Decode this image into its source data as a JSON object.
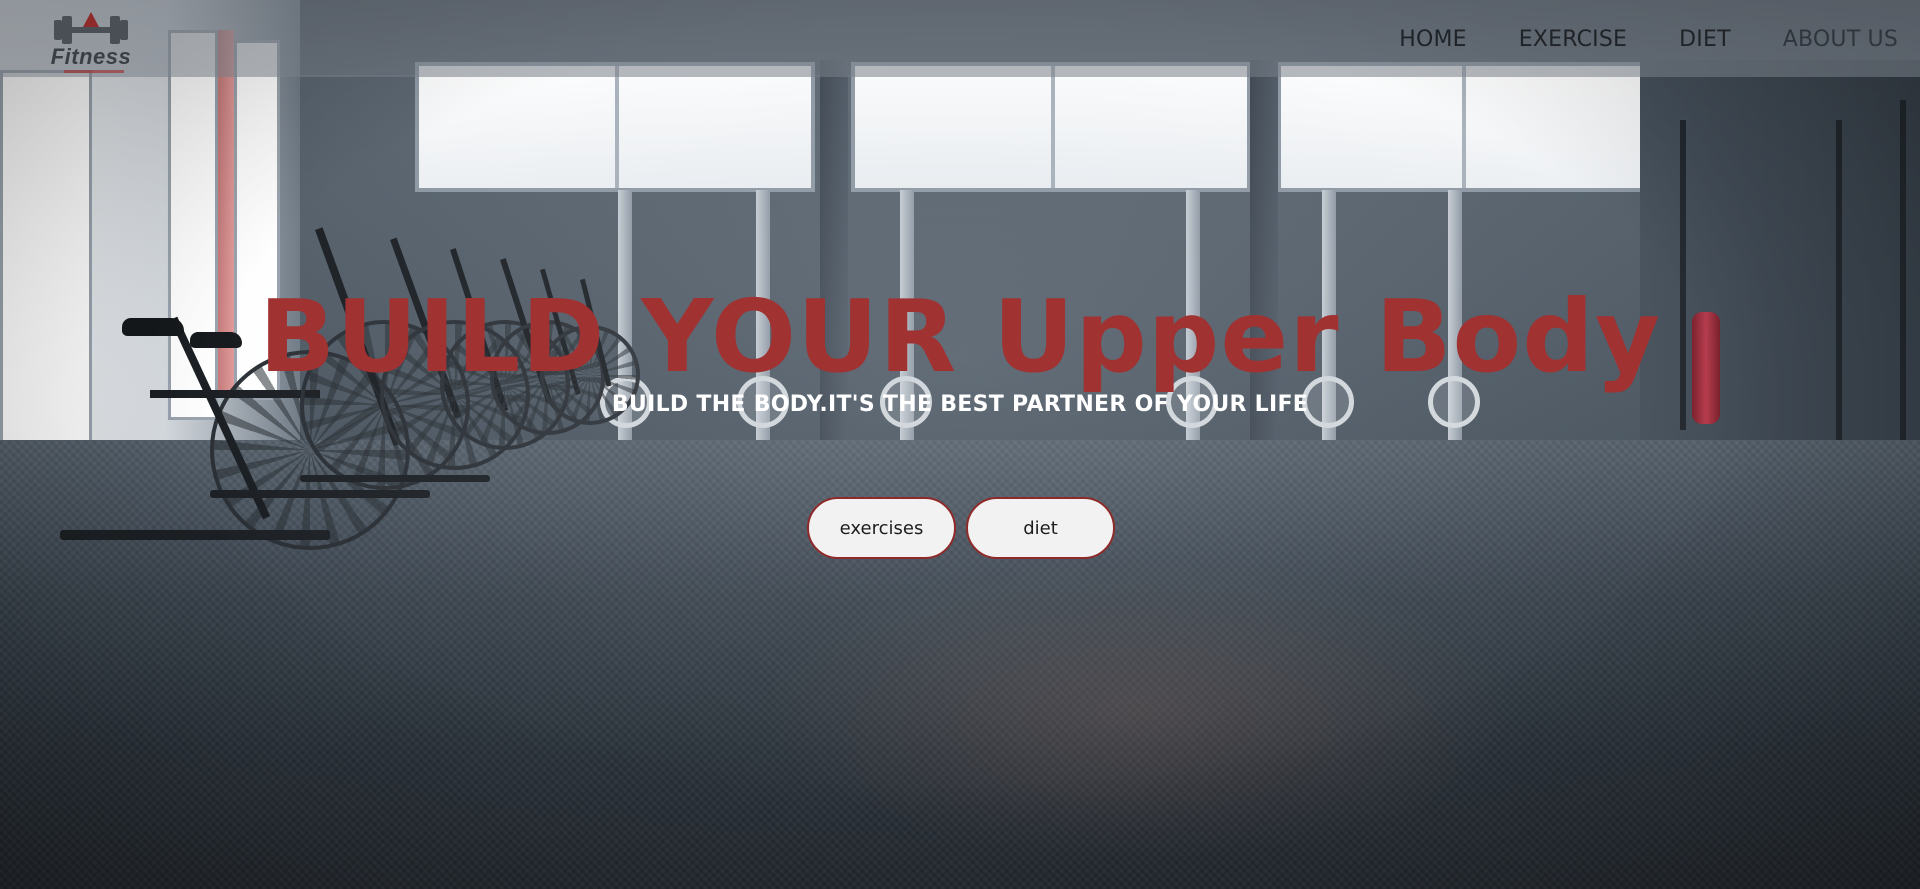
{
  "brand": {
    "logo_text": "Fitness",
    "logo_icon": "dumbbell-icon",
    "accent_color": "#a03232"
  },
  "nav": {
    "items": [
      {
        "label": "HOME"
      },
      {
        "label": "EXERCISE"
      },
      {
        "label": "DIET"
      },
      {
        "label": "ABOUT US"
      }
    ]
  },
  "hero": {
    "title": "BUILD YOUR Upper Body",
    "subtitle": "BUILD THE BODY.IT'S THE BEST PARTNER OF YOUR LIFE",
    "buttons": [
      {
        "label": "exercises"
      },
      {
        "label": "diet"
      }
    ]
  }
}
